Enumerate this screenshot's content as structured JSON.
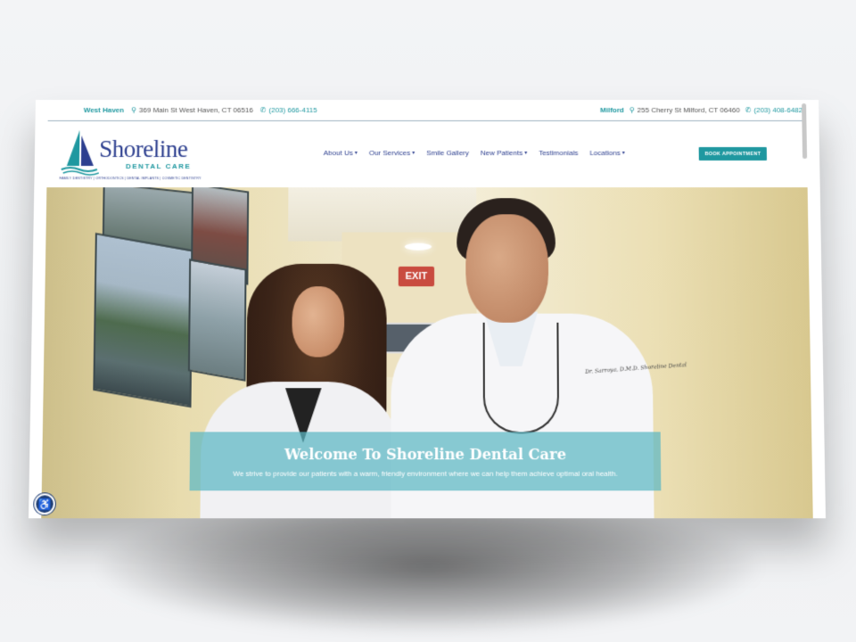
{
  "topbar": {
    "left": {
      "location": "West Haven",
      "address": "369 Main St West Haven, CT 06516",
      "phone": "(203) 666-4115"
    },
    "right": {
      "location": "Milford",
      "address": "255 Cherry St Milford, CT 06460",
      "phone": "(203) 408-6482"
    }
  },
  "logo": {
    "name": "Shoreline",
    "sub": "DENTAL CARE",
    "tagline": "FAMILY DENTISTRY | ORTHODONTICS | DENTAL IMPLANTS | COSMETIC DENTISTRY"
  },
  "nav": {
    "items": [
      {
        "label": "About Us",
        "dropdown": true
      },
      {
        "label": "Our Services",
        "dropdown": true
      },
      {
        "label": "Smile Gallery",
        "dropdown": false
      },
      {
        "label": "New Patients",
        "dropdown": true
      },
      {
        "label": "Testimonials",
        "dropdown": false
      },
      {
        "label": "Locations",
        "dropdown": true
      }
    ],
    "cta": "BOOK APPOINTMENT"
  },
  "hero": {
    "exit_sign": "EXIT",
    "badge": "Dr. Sarroya, D.M.D. Shoreline Dental",
    "title": "Welcome To Shoreline Dental Care",
    "subtitle": "We strive to provide our patients with a warm, friendly environment where we can help them achieve optimal oral health."
  },
  "icons": {
    "location": "map-pin-icon",
    "phone": "phone-icon",
    "accessibility": "accessibility-icon",
    "caret": "chevron-down-icon"
  },
  "colors": {
    "brand_teal": "#1f98a0",
    "brand_navy": "#2d3f8f",
    "overlay": "#5cb7c4"
  }
}
